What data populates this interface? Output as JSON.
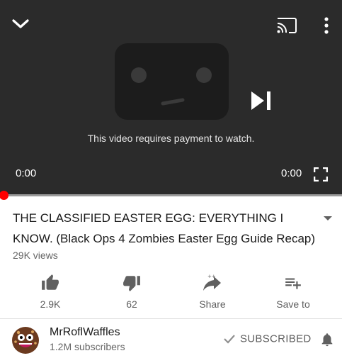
{
  "player": {
    "message": "This video requires payment to watch.",
    "current_time": "0:00",
    "duration": "0:00",
    "progress": 0,
    "accent_color": "#ff0000",
    "icons": {
      "collapse": "chevron-down-icon",
      "cast": "cast-icon",
      "more": "more-vert-icon",
      "next": "skip-next-icon",
      "fullscreen": "fullscreen-icon"
    }
  },
  "video": {
    "title": "THE CLASSIFIED EASTER EGG: EVERYTHING I KNOW. (Black Ops 4 Zombies Easter Egg Guide Recap)",
    "views": "29K views"
  },
  "actions": {
    "like": "2.9K",
    "dislike": "62",
    "share": "Share",
    "save": "Save to"
  },
  "channel": {
    "name": "MrRoflWaffles",
    "subscribers": "1.2M subscribers",
    "subscribe_label": "SUBSCRIBED"
  }
}
